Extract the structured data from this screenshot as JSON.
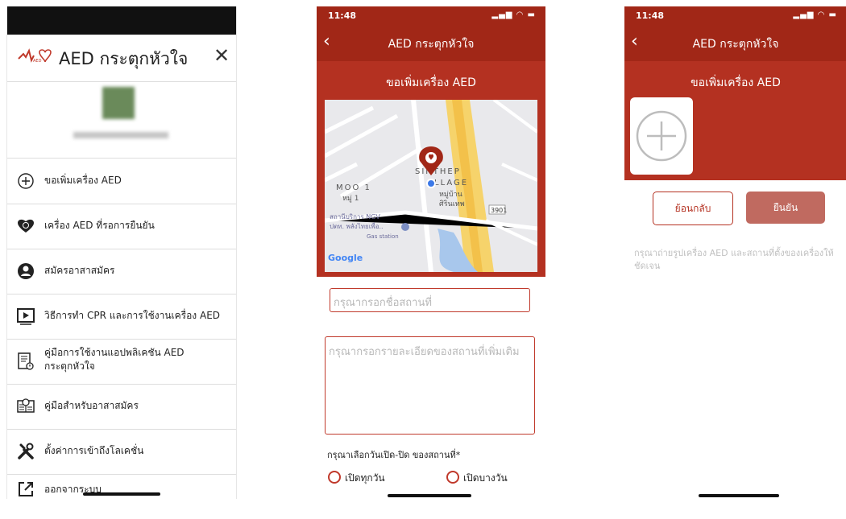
{
  "menu_screen": {
    "app_title": "AED กระตุกหัวใจ",
    "close_icon": "close-icon",
    "items": [
      {
        "label": "ขอเพิ่มเครื่อง AED",
        "icon": "plus-circle-icon"
      },
      {
        "label": "เครื่อง AED ที่รอการยืนยัน",
        "icon": "heart-clock-icon"
      },
      {
        "label": "สมัครอาสาสมัคร",
        "icon": "user-circle-icon"
      },
      {
        "label": "วิธีการทำ CPR และการใช้งานเครื่อง AED",
        "icon": "play-video-icon"
      },
      {
        "label_line1": "คู่มือการใช้งานแอปพลิเคชัน AED",
        "label_line2": "กระตุกหัวใจ",
        "icon": "manual-book-icon"
      },
      {
        "label": "คู่มือสำหรับอาสาสมัคร",
        "icon": "volunteer-guide-icon"
      },
      {
        "label": "ตั้งค่าการเข้าถึงโลเคชั่น",
        "icon": "tools-icon"
      },
      {
        "label": "ออกจากระบบ",
        "icon": "logout-icon"
      }
    ]
  },
  "form_screen": {
    "status_time": "11:48",
    "nav_title": "AED กระตุกหัวใจ",
    "subtitle": "ขอเพิ่มเครื่อง AED",
    "map": {
      "labels": [
        "MOO 1",
        "หมู่ 1",
        "SINTHEP",
        "VILLAGE",
        "หมู่บ้าน",
        "ศิรินเทพ",
        "3901",
        "สถานีบริการ NGV",
        "ปตท. พลังไทยเพื่อ...",
        "Gas station",
        "Google"
      ]
    },
    "place_name_placeholder": "กรุณากรอกชื่อสถานที่",
    "place_detail_placeholder": "กรุณากรอกรายละเอียดของสถานที่เพิ่มเติม",
    "hours_label": "กรุณาเลือกวันเปิด-ปิด ของสถานที่*",
    "option_everyday": "เปิดทุกวัน",
    "option_somedays": "เปิดบางวัน"
  },
  "photo_screen": {
    "status_time": "11:48",
    "nav_title": "AED กระตุกหัวใจ",
    "subtitle": "ขอเพิ่มเครื่อง AED",
    "back_button": "ย้อนกลับ",
    "confirm_button": "ยืนยัน",
    "hint": "กรุณาถ่ายรูปเครื่อง AED และสถานที่ตั้งของเครื่องให้ชัดเจน"
  },
  "colors": {
    "brand_red": "#a12717",
    "accent_red": "#b43121",
    "confirm_muted": "#c06a60"
  }
}
